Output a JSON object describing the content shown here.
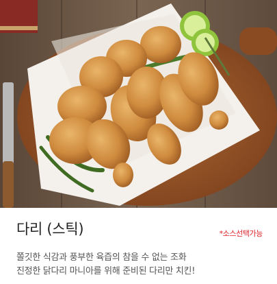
{
  "product": {
    "title": "다리 (스틱)",
    "sauce_note": "*소스선택가능",
    "description_lines": [
      "쫄깃한 식감과 풍부한 육즙의 참을 수 없는 조화",
      "진정한 닭다리 마니아를 위해 준비된 다리만 치킨!"
    ],
    "image_subject": "fried-chicken-drumsticks-photo"
  },
  "colors": {
    "accent_red": "#e0202a",
    "title_text": "#222222",
    "body_text": "#555555"
  }
}
